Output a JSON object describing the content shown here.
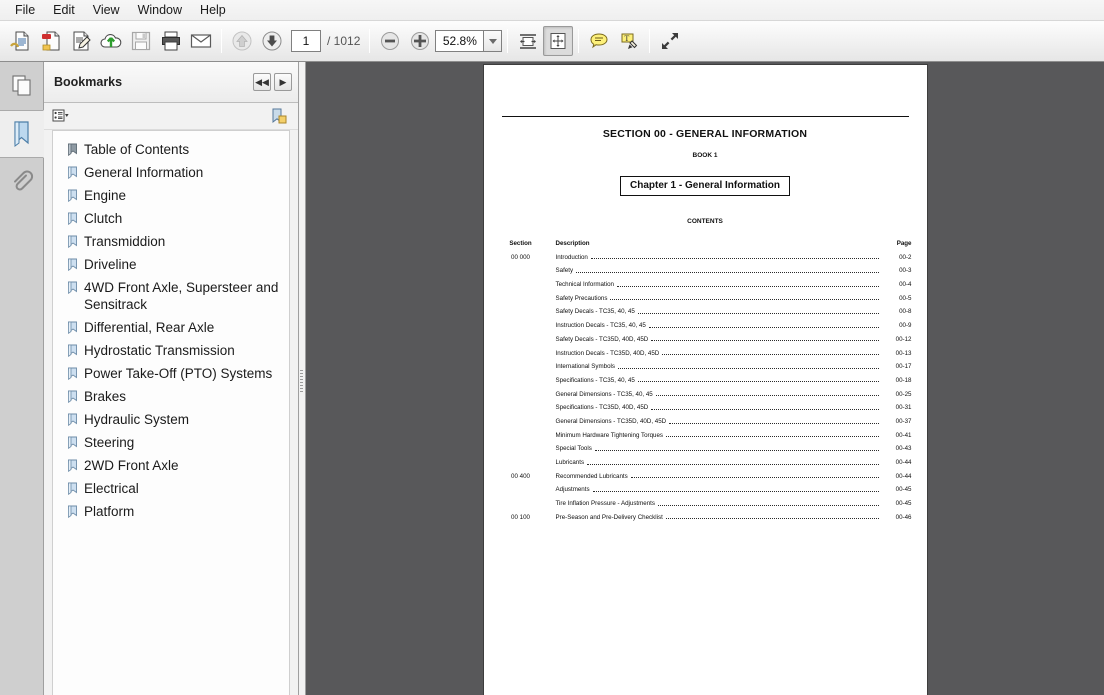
{
  "window": {
    "menus": [
      "File",
      "Edit",
      "View",
      "Window",
      "Help"
    ]
  },
  "toolbar": {
    "buttons": [
      {
        "name": "open-file-icon",
        "label": "Open"
      },
      {
        "name": "create-pdf-icon",
        "label": "Create PDF"
      },
      {
        "name": "edit-pdf-icon",
        "label": "Edit PDF"
      },
      {
        "name": "upload-cloud-icon",
        "label": "Upload to cloud"
      },
      {
        "name": "save-icon",
        "label": "Save"
      },
      {
        "name": "print-icon",
        "label": "Print"
      },
      {
        "name": "email-icon",
        "label": "Email"
      }
    ],
    "previous_page_label": "Previous page",
    "next_page_label": "Next page",
    "page_number": "1",
    "page_total": "/ 1012",
    "zoom_out_label": "Zoom out",
    "zoom_in_label": "Zoom in",
    "zoom_value": "52.8%",
    "fit_width_label": "Fit width",
    "fit_page_label": "Fit page",
    "sticky_note_label": "Sticky note",
    "highlight_text_label": "Highlight text",
    "fullscreen_label": "Full screen"
  },
  "rail": {
    "items": [
      {
        "name": "page-thumbnails-icon",
        "label": "Page Thumbnails",
        "selected": false
      },
      {
        "name": "bookmarks-icon",
        "label": "Bookmarks",
        "selected": true
      },
      {
        "name": "attachments-icon",
        "label": "Attachments",
        "selected": false
      }
    ]
  },
  "panel": {
    "title": "Bookmarks",
    "collapse_label": "◀◀",
    "expand_label": "▶",
    "options_menu_label": "Options",
    "expand_current_bookmark_label": "Expand current bookmark",
    "bookmarks": [
      "Table of Contents",
      "General Information",
      "Engine",
      "Clutch",
      "Transmiddion",
      "Driveline",
      "4WD Front Axle, Supersteer and Sensitrack",
      "Differential, Rear Axle",
      "Hydrostatic Transmission",
      "Power Take-Off (PTO) Systems",
      "Brakes",
      "Hydraulic System",
      "Steering",
      "2WD Front Axle",
      "Electrical",
      "Platform"
    ]
  },
  "document": {
    "heading": "SECTION 00 - GENERAL INFORMATION",
    "book": "BOOK 1",
    "chapter": "Chapter 1 - General Information",
    "contents_label": "CONTENTS",
    "columns": {
      "section": "Section",
      "description": "Description",
      "page": "Page"
    },
    "rows": [
      {
        "section": "00 000",
        "description": "Introduction",
        "page": "00-2"
      },
      {
        "section": "",
        "description": "Safety",
        "page": "00-3"
      },
      {
        "section": "",
        "description": "Technical Information",
        "page": "00-4"
      },
      {
        "section": "",
        "description": "Safety Precautions",
        "page": "00-5"
      },
      {
        "section": "",
        "description": "Safety Decals - TC35, 40, 45",
        "page": "00-8"
      },
      {
        "section": "",
        "description": "Instruction Decals - TC35, 40, 45",
        "page": "00-9"
      },
      {
        "section": "",
        "description": "Safety Decals - TC35D, 40D, 45D",
        "page": "00-12"
      },
      {
        "section": "",
        "description": "Instruction Decals - TC35D, 40D, 45D",
        "page": "00-13"
      },
      {
        "section": "",
        "description": "International Symbols",
        "page": "00-17"
      },
      {
        "section": "",
        "description": "Specifications - TC35, 40, 45",
        "page": "00-18"
      },
      {
        "section": "",
        "description": "General Dimensions - TC35, 40, 45",
        "page": "00-25"
      },
      {
        "section": "",
        "description": "Specifications - TC35D, 40D, 45D",
        "page": "00-31"
      },
      {
        "section": "",
        "description": "General Dimensions - TC35D, 40D, 45D",
        "page": "00-37"
      },
      {
        "section": "",
        "description": "Minimum Hardware Tightening Torques",
        "page": "00-41"
      },
      {
        "section": "",
        "description": "Special Tools",
        "page": "00-43"
      },
      {
        "section": "",
        "description": "Lubricants",
        "page": "00-44"
      },
      {
        "section": "00 400",
        "description": "Recommended Lubricants",
        "page": "00-44"
      },
      {
        "section": "",
        "description": "Adjustments",
        "page": "00-45"
      },
      {
        "section": "",
        "description": "Tire Inflation Pressure - Adjustments",
        "page": "00-45"
      },
      {
        "section": "00 100",
        "description": "Pre-Season and Pre-Delivery Checklist",
        "page": "00-46"
      }
    ]
  },
  "colors": {
    "doc_background": "#58585a",
    "panel_background": "#f2f2f2",
    "rail_background": "#cfcfcf",
    "accent": "#3b6ea5"
  }
}
